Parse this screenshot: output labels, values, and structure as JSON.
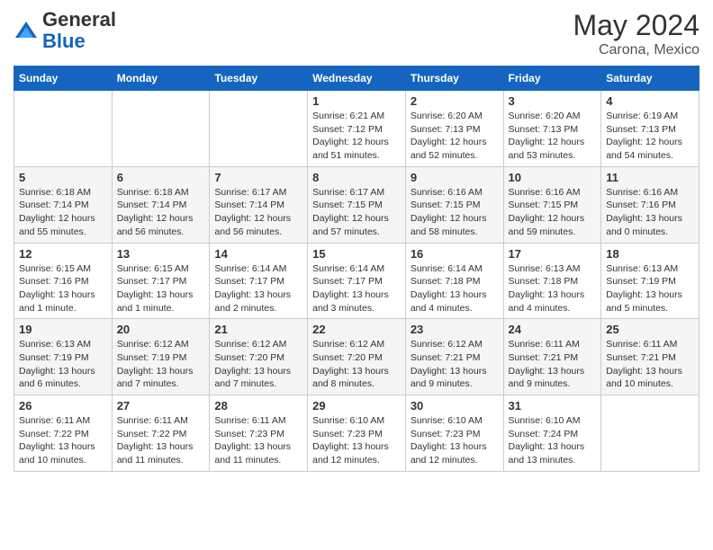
{
  "header": {
    "logo_general": "General",
    "logo_blue": "Blue",
    "month": "May 2024",
    "location": "Carona, Mexico"
  },
  "days_of_week": [
    "Sunday",
    "Monday",
    "Tuesday",
    "Wednesday",
    "Thursday",
    "Friday",
    "Saturday"
  ],
  "weeks": [
    [
      {
        "day": "",
        "info": ""
      },
      {
        "day": "",
        "info": ""
      },
      {
        "day": "",
        "info": ""
      },
      {
        "day": "1",
        "info": "Sunrise: 6:21 AM\nSunset: 7:12 PM\nDaylight: 12 hours\nand 51 minutes."
      },
      {
        "day": "2",
        "info": "Sunrise: 6:20 AM\nSunset: 7:13 PM\nDaylight: 12 hours\nand 52 minutes."
      },
      {
        "day": "3",
        "info": "Sunrise: 6:20 AM\nSunset: 7:13 PM\nDaylight: 12 hours\nand 53 minutes."
      },
      {
        "day": "4",
        "info": "Sunrise: 6:19 AM\nSunset: 7:13 PM\nDaylight: 12 hours\nand 54 minutes."
      }
    ],
    [
      {
        "day": "5",
        "info": "Sunrise: 6:18 AM\nSunset: 7:14 PM\nDaylight: 12 hours\nand 55 minutes."
      },
      {
        "day": "6",
        "info": "Sunrise: 6:18 AM\nSunset: 7:14 PM\nDaylight: 12 hours\nand 56 minutes."
      },
      {
        "day": "7",
        "info": "Sunrise: 6:17 AM\nSunset: 7:14 PM\nDaylight: 12 hours\nand 56 minutes."
      },
      {
        "day": "8",
        "info": "Sunrise: 6:17 AM\nSunset: 7:15 PM\nDaylight: 12 hours\nand 57 minutes."
      },
      {
        "day": "9",
        "info": "Sunrise: 6:16 AM\nSunset: 7:15 PM\nDaylight: 12 hours\nand 58 minutes."
      },
      {
        "day": "10",
        "info": "Sunrise: 6:16 AM\nSunset: 7:15 PM\nDaylight: 12 hours\nand 59 minutes."
      },
      {
        "day": "11",
        "info": "Sunrise: 6:16 AM\nSunset: 7:16 PM\nDaylight: 13 hours\nand 0 minutes."
      }
    ],
    [
      {
        "day": "12",
        "info": "Sunrise: 6:15 AM\nSunset: 7:16 PM\nDaylight: 13 hours\nand 1 minute."
      },
      {
        "day": "13",
        "info": "Sunrise: 6:15 AM\nSunset: 7:17 PM\nDaylight: 13 hours\nand 1 minute."
      },
      {
        "day": "14",
        "info": "Sunrise: 6:14 AM\nSunset: 7:17 PM\nDaylight: 13 hours\nand 2 minutes."
      },
      {
        "day": "15",
        "info": "Sunrise: 6:14 AM\nSunset: 7:17 PM\nDaylight: 13 hours\nand 3 minutes."
      },
      {
        "day": "16",
        "info": "Sunrise: 6:14 AM\nSunset: 7:18 PM\nDaylight: 13 hours\nand 4 minutes."
      },
      {
        "day": "17",
        "info": "Sunrise: 6:13 AM\nSunset: 7:18 PM\nDaylight: 13 hours\nand 4 minutes."
      },
      {
        "day": "18",
        "info": "Sunrise: 6:13 AM\nSunset: 7:19 PM\nDaylight: 13 hours\nand 5 minutes."
      }
    ],
    [
      {
        "day": "19",
        "info": "Sunrise: 6:13 AM\nSunset: 7:19 PM\nDaylight: 13 hours\nand 6 minutes."
      },
      {
        "day": "20",
        "info": "Sunrise: 6:12 AM\nSunset: 7:19 PM\nDaylight: 13 hours\nand 7 minutes."
      },
      {
        "day": "21",
        "info": "Sunrise: 6:12 AM\nSunset: 7:20 PM\nDaylight: 13 hours\nand 7 minutes."
      },
      {
        "day": "22",
        "info": "Sunrise: 6:12 AM\nSunset: 7:20 PM\nDaylight: 13 hours\nand 8 minutes."
      },
      {
        "day": "23",
        "info": "Sunrise: 6:12 AM\nSunset: 7:21 PM\nDaylight: 13 hours\nand 9 minutes."
      },
      {
        "day": "24",
        "info": "Sunrise: 6:11 AM\nSunset: 7:21 PM\nDaylight: 13 hours\nand 9 minutes."
      },
      {
        "day": "25",
        "info": "Sunrise: 6:11 AM\nSunset: 7:21 PM\nDaylight: 13 hours\nand 10 minutes."
      }
    ],
    [
      {
        "day": "26",
        "info": "Sunrise: 6:11 AM\nSunset: 7:22 PM\nDaylight: 13 hours\nand 10 minutes."
      },
      {
        "day": "27",
        "info": "Sunrise: 6:11 AM\nSunset: 7:22 PM\nDaylight: 13 hours\nand 11 minutes."
      },
      {
        "day": "28",
        "info": "Sunrise: 6:11 AM\nSunset: 7:23 PM\nDaylight: 13 hours\nand 11 minutes."
      },
      {
        "day": "29",
        "info": "Sunrise: 6:10 AM\nSunset: 7:23 PM\nDaylight: 13 hours\nand 12 minutes."
      },
      {
        "day": "30",
        "info": "Sunrise: 6:10 AM\nSunset: 7:23 PM\nDaylight: 13 hours\nand 12 minutes."
      },
      {
        "day": "31",
        "info": "Sunrise: 6:10 AM\nSunset: 7:24 PM\nDaylight: 13 hours\nand 13 minutes."
      },
      {
        "day": "",
        "info": ""
      }
    ]
  ]
}
